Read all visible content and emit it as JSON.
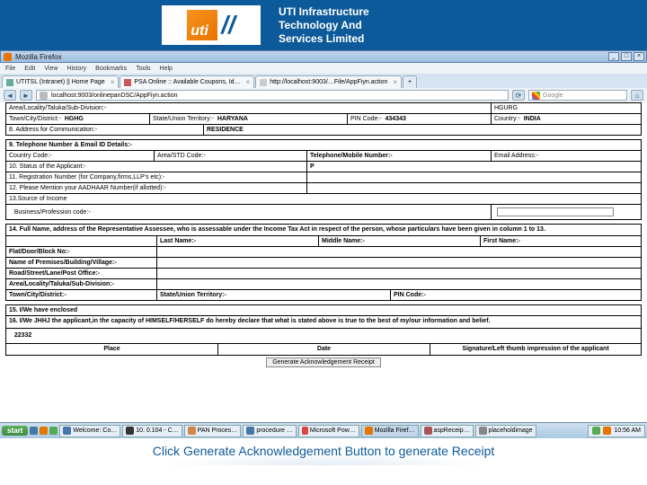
{
  "banner": {
    "tagline_l1": "UTI Infrastructure",
    "tagline_l2": "Technology And",
    "tagline_l3": "Services Limited"
  },
  "window": {
    "title": "Mozilla Firefox",
    "menu": [
      "File",
      "Edit",
      "View",
      "History",
      "Bookmarks",
      "Tools",
      "Help"
    ],
    "tabs": [
      "UTITSL (Intranet) || Home Page",
      "PSA Online :: Available Coupons, Id…",
      "http://localhost:9003/…File/AppFiyn.action"
    ],
    "url": "localhost:9003/onlinepanDSC/AppFiyn.action",
    "search_placeholder": "Google"
  },
  "form": {
    "sec_area": {
      "label": "Area/Locality/Taluka/Sub-Division:-",
      "value": "HGURG"
    },
    "town": {
      "label": "Town/City/District:-",
      "value": "HGHG"
    },
    "state": {
      "label": "State/Union Territory:-",
      "value": "HARYANA"
    },
    "pin": {
      "label": "PIN Code:-",
      "value": "434343"
    },
    "country": {
      "label": "Country:-",
      "value": "INDIA"
    },
    "s8": {
      "label": "8. Address for Communication:-",
      "value": "RESIDENCE"
    },
    "s9_header": "9. Telephone Number & Email ID Details:-",
    "cc": {
      "label": "Country Code:-"
    },
    "std": {
      "label": "Area/STD Code:-"
    },
    "tel": {
      "label": "Telephone/Mobile Number:-"
    },
    "email": {
      "label": "Email Address:-"
    },
    "s10": {
      "label": "10. Status of the Applicant:-",
      "value": "P"
    },
    "s11": {
      "label": "11. Registration Number (for Company,firms,LLP's etc):-"
    },
    "s12": {
      "label": "12. Please Mention your AADHAAR Number(if allotted):-"
    },
    "s13": {
      "label": "13.Source of Income"
    },
    "biz": {
      "label": "Business/Profession code:-"
    },
    "s14_text": "14. Full Name, address of the Representative Assessee, who is assessable under the Income Tax Act in respect of the person, whose particulars have been given in column 1 to 13.",
    "lname": "Last Name:-",
    "mname": "Middle Name:-",
    "fname": "First Name:-",
    "flat": "Flat/Door/Block No:-",
    "premises": "Name of Premises/Building/Village:-",
    "road": "Road/Street/Lane/Post Office:-",
    "area2": "Area/Locality/Taluka/Sub-Division:-",
    "town2": "Town/City/District:-",
    "state2": "State/Union Territory:-",
    "pin2": "PIN Code:-",
    "s15": "15. I/We have enclosed",
    "s16": "16. I/We   JHHJ the applicant,in the capacity of HIMSELF/HERSELF do hereby declare that what is stated above is true to the best of my/our information and belief.",
    "doc": "22332",
    "place": "Place",
    "date": "Date",
    "sig": "Signature/Left thumb impression of the applicant",
    "btn": "Generate Acknowledgement Receipt"
  },
  "taskbar": {
    "start": "start",
    "items": [
      "",
      "Welcome: Co…",
      "10. 0.104 - C…",
      "PAN Proces…",
      "procedure …",
      "Microsoft Pow…",
      "Mozilla Firef…",
      "aspReceip…",
      "placeholdimage"
    ],
    "time": "10:56 AM"
  },
  "caption": "Click Generate Acknowledgement Button to generate Receipt"
}
